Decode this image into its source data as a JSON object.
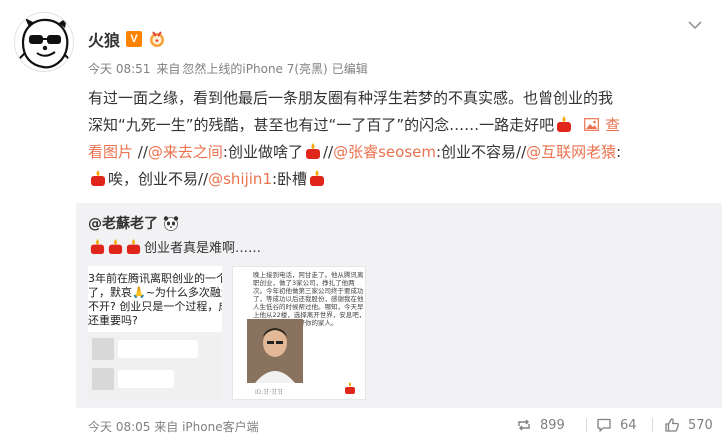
{
  "post": {
    "author": "火狼",
    "vip_badge": "V",
    "meta": {
      "time": "今天 08:51",
      "source_prefix": "来自",
      "source": "忽然上线的iPhone 7(亮黑)",
      "edited": "已编辑"
    },
    "text": {
      "line1": "有过一面之缘，看到他最后一条朋友圈有种浮生若梦的不真实感。也曾创业的我",
      "line2": "深知“九死一生”的残酷，甚至也有过“一了百了”的闪念……一路走好吧",
      "view_photo_a": "查",
      "view_photo_b": "看图片",
      "seg1": " //",
      "mention1": "@来去之间",
      "seg2": ":创业做啥了",
      "seg3": "//",
      "mention2": "@张睿seosem",
      "seg4": ":创业不容易//",
      "mention3": "@互联网老猿",
      "seg5": ":",
      "seg6": "唉，创业不易//",
      "mention4": "@shijin1",
      "seg7": ":卧槽"
    }
  },
  "repost": {
    "user": "@老蘇老了",
    "text": "创业者真是难啊……",
    "thumb1_text": "3年前在腾讯离职创业的一个老\n了，默哀🙏~为什么多次融资\n不开? 创业只是一个过程，成\n还重要吗?",
    "thumb2_text": "晚上接到电话，阿甘走了。他从腾讯离\n职创业，做了3家公司，挣扎了他两\n次。今年初他做第三家公司终于要成功\n了，等成功以后还我股份，感谢我在他\n人生低谷的时候帮过他。哪知，今天早\n上他从22楼，选择离开世界，安息吧，\n我们会帮你照顾好你的家人。",
    "thumb2_sig": "ID:甘·甘甘",
    "time": "今天 08:05",
    "source_prefix": "来自",
    "source": "iPhone客户端"
  },
  "actions": {
    "reposts": "899",
    "comments": "64",
    "likes": "570"
  },
  "colors": {
    "link": "#eb7350",
    "meta": "#808080",
    "repost_bg": "#f2f2f5",
    "vip": "#ff8200"
  },
  "icons": [
    "avatar-raccoon-sunglasses",
    "vip-badge",
    "medal-icon",
    "chevron-down-icon",
    "photo-icon",
    "panda-icon",
    "candle-emoji",
    "repost-icon",
    "comment-icon",
    "like-icon"
  ]
}
